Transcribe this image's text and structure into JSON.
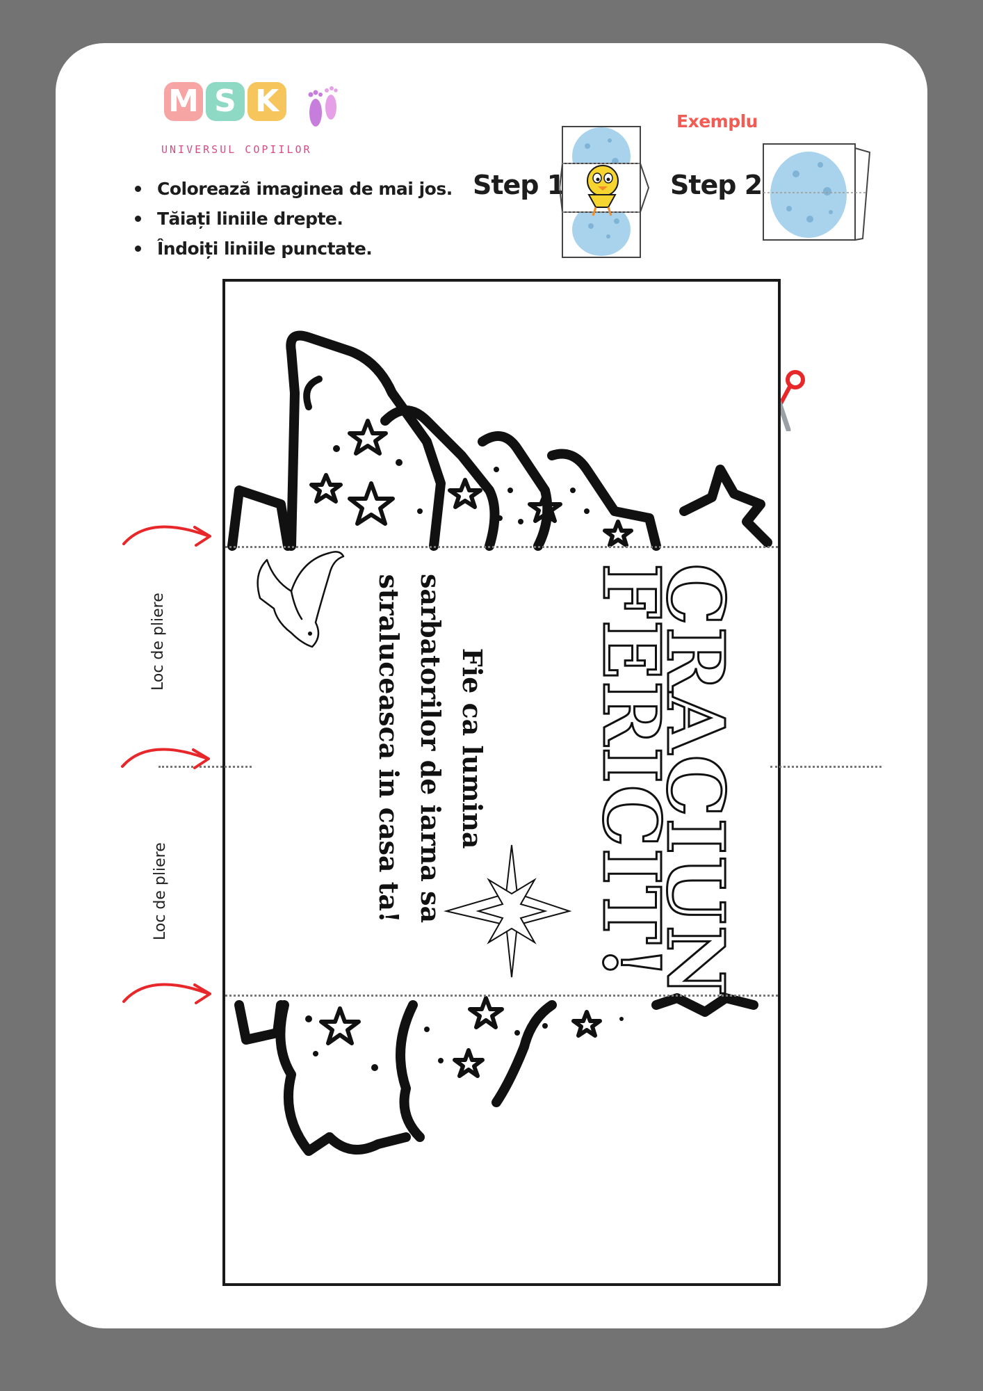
{
  "logo": {
    "letters": [
      "M",
      "S",
      "K"
    ],
    "letter_colors": [
      "#f7a4a4",
      "#8dd9c4",
      "#f6c55c"
    ],
    "feet_color": "#c77ddb",
    "subtitle": "UNIVERSUL COPIILOR"
  },
  "instructions": [
    "Colorează imaginea de mai jos.",
    "Tăiați liniile drepte.",
    "Îndoiți liniile punctate."
  ],
  "steps": {
    "step1_label": "Step 1",
    "step2_label": "Step 2",
    "example_label": "Exemplu"
  },
  "card": {
    "title_line1": "CRACIUN",
    "title_line2": "FERICIT!",
    "message_lines": [
      "Fie ca lumina",
      "sarbatorilor de iarna sa",
      "straluceasca in casa ta!"
    ]
  },
  "side_labels": {
    "fold_upper": "Loc de pliere",
    "fold_lower": "Loc de pliere"
  },
  "colors": {
    "background": "#737373",
    "arrow": "#e8272a",
    "scissors_handle": "#e8272a",
    "egg": "#a9d3ec",
    "example": "#f25c54"
  },
  "icons": [
    "scissors-icon",
    "dove-icon",
    "star-icon",
    "christmas-tree-icon",
    "arrow-icon",
    "chick-icon",
    "egg-icon"
  ]
}
